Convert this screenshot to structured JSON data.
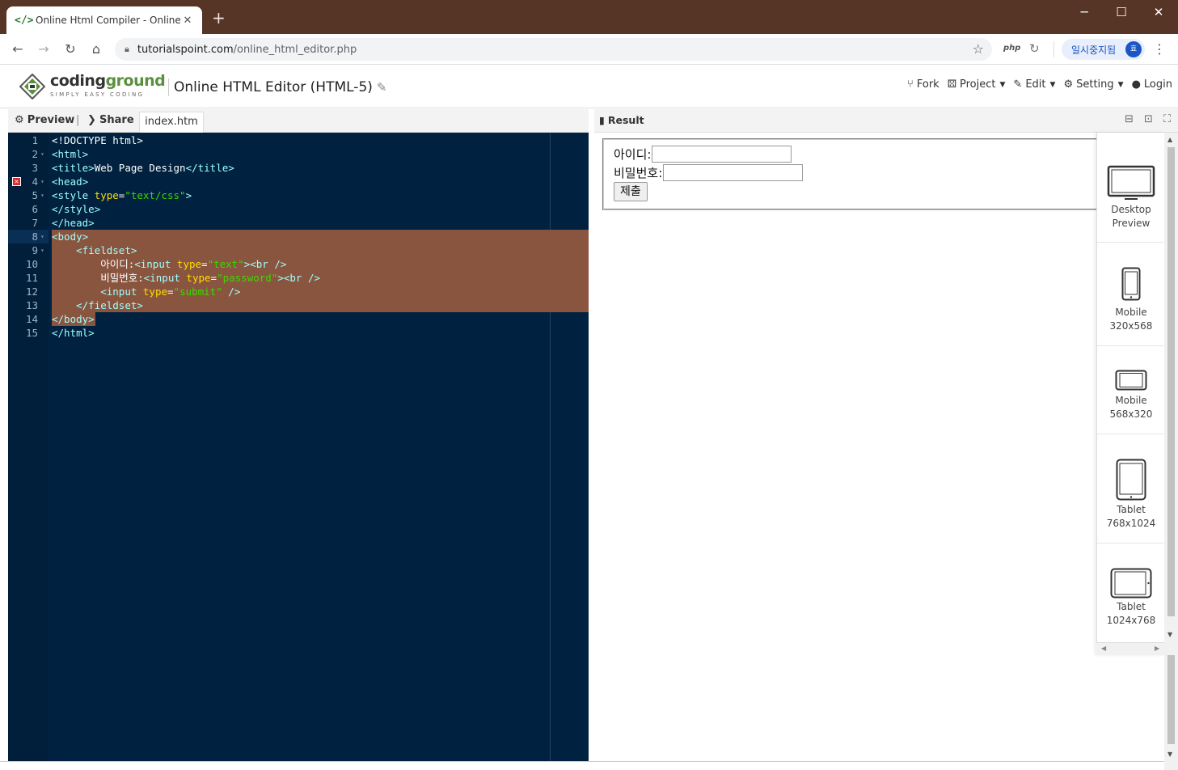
{
  "browser": {
    "tab_title": "Online Html Compiler - Online H",
    "tab_icon": "</>",
    "url_host": "tutorialspoint.com",
    "url_path": "/online_html_editor.php",
    "ext_php": "php",
    "pause_label": "일시중지됨",
    "avatar_initial": "효"
  },
  "header": {
    "logo_main": "coding",
    "logo_accent": "ground",
    "logo_sub": "SIMPLY EASY CODING",
    "title": "Online HTML Editor (HTML-5)",
    "menu": [
      {
        "label": "Fork"
      },
      {
        "label": "Project"
      },
      {
        "label": "Edit"
      },
      {
        "label": "Setting"
      },
      {
        "label": "Login"
      }
    ]
  },
  "editor": {
    "preview_label": "Preview",
    "share_label": "Share",
    "file_tab": "index.htm",
    "lines": [
      "<!DOCTYPE html>",
      "<html>",
      "<title>Web Page Design</title>",
      "<head>",
      "<style type=\"text/css\">",
      "</style>",
      "</head>",
      "<body>",
      "    <fieldset>",
      "        아이디:<input type=\"text\"><br />",
      "        비밀번호:<input type=\"password\"><br />",
      "        <input type=\"submit\" />",
      "    </fieldset>",
      "</body>",
      "</html>"
    ],
    "line_numbers": [
      "1",
      "2",
      "3",
      "4",
      "5",
      "6",
      "7",
      "8",
      "9",
      "10",
      "11",
      "12",
      "13",
      "14",
      "15"
    ]
  },
  "result": {
    "title": "Result",
    "form": {
      "id_label": "아이디:",
      "pw_label": "비밀번호:",
      "submit_label": "제출"
    },
    "devices": [
      {
        "line1": "Desktop",
        "line2": "Preview"
      },
      {
        "line1": "Mobile",
        "line2": "320x568"
      },
      {
        "line1": "Mobile",
        "line2": "568x320"
      },
      {
        "line1": "Tablet",
        "line2": "768x1024"
      },
      {
        "line1": "Tablet",
        "line2": "1024x768"
      }
    ]
  },
  "colors": {
    "titlebar": "#563527",
    "editor_bg": "#002240",
    "selection": "#8a553f",
    "tag": "#9effff",
    "attr": "#ffdd00",
    "string": "#3ad900"
  }
}
